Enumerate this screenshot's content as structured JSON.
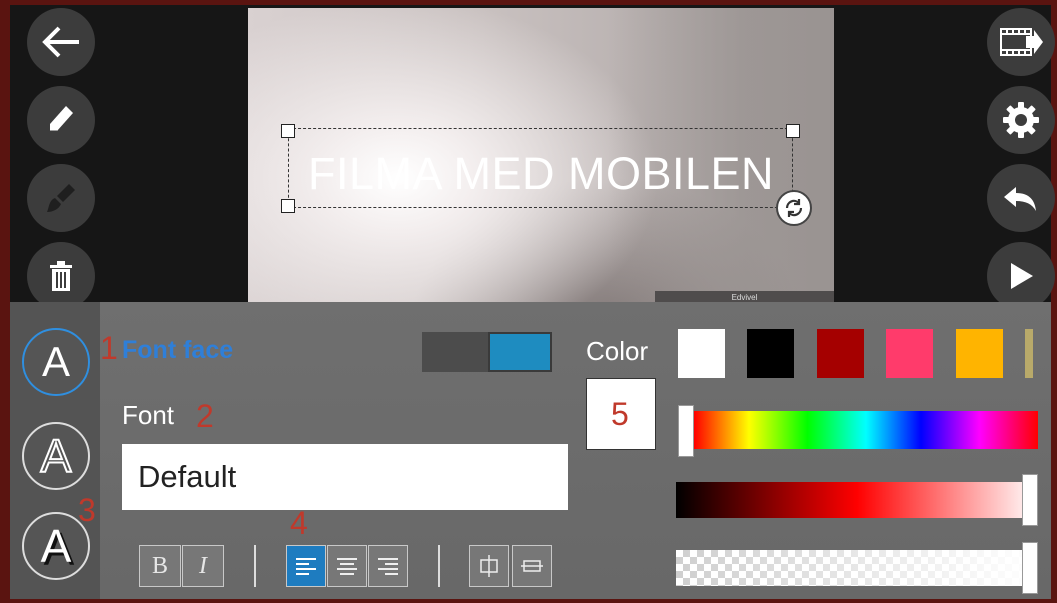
{
  "preview": {
    "caption": "FILMA MED MOBILEN",
    "mini_tab": "Edvivel"
  },
  "left_toolbar": {
    "items": [
      "back-arrow-icon",
      "pencil-icon",
      "brush-icon",
      "trash-icon"
    ]
  },
  "right_toolbar": {
    "items": [
      "export-film-icon",
      "gear-icon",
      "undo-icon",
      "play-icon"
    ]
  },
  "text_panel": {
    "style_buttons": [
      {
        "glyph": "A",
        "style": "plain",
        "selected": true
      },
      {
        "glyph": "A",
        "style": "outline",
        "selected": false
      },
      {
        "glyph": "A",
        "style": "shadow",
        "selected": false
      }
    ],
    "annotations": {
      "n1": "1",
      "n2": "2",
      "n3": "3",
      "n4": "4",
      "n5": "5"
    },
    "font_face_label": "Font face",
    "font_face_toggle": "on",
    "font_label": "Font",
    "font_value": "Default",
    "bold_label": "B",
    "italic_label": "I",
    "align": [
      "left",
      "center",
      "right"
    ],
    "align_selected": "left",
    "fit": [
      "fit-vertical-icon",
      "fit-horizontal-icon"
    ]
  },
  "color_panel": {
    "label": "Color",
    "current": "#ffffff",
    "swatches": [
      "#ffffff",
      "#000000",
      "#a50000",
      "#ff3b6b",
      "#ffb400",
      "#b9aa6a"
    ],
    "hue_level": 0.0,
    "shade_level": 1.0,
    "alpha_level": 1.0
  }
}
